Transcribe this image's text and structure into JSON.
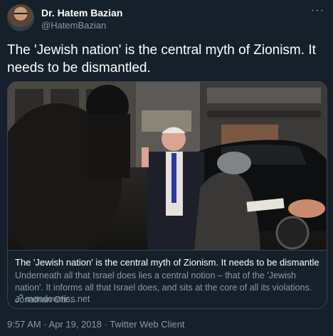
{
  "author": {
    "display_name": "Dr. Hatem Bazian",
    "handle": "@HatemBazian"
  },
  "menu_icon": "more-dots-icon",
  "tweet": {
    "text": "The 'Jewish nation' is the central myth of Zionism. It needs to be dismantled."
  },
  "card": {
    "image_alt": "news-photo",
    "title": "The 'Jewish nation' is the central myth of Zionism. It needs to be dismantled. – ...",
    "description": "Underneath all that Israel does lies a central notion – that of the 'Jewish nation'. It informs all that Israel does, and sits at the core of all its violations. Jonathan Ofir...",
    "domain": "mondoweiss.net",
    "link_icon": "link-icon"
  },
  "meta": {
    "timestamp": "9:57 AM · Apr 19, 2018 · Twitter Web Client"
  },
  "colors": {
    "background": "#15202b",
    "border": "#38444d",
    "muted_text": "#8899a6",
    "primary_text": "#ffffff"
  }
}
